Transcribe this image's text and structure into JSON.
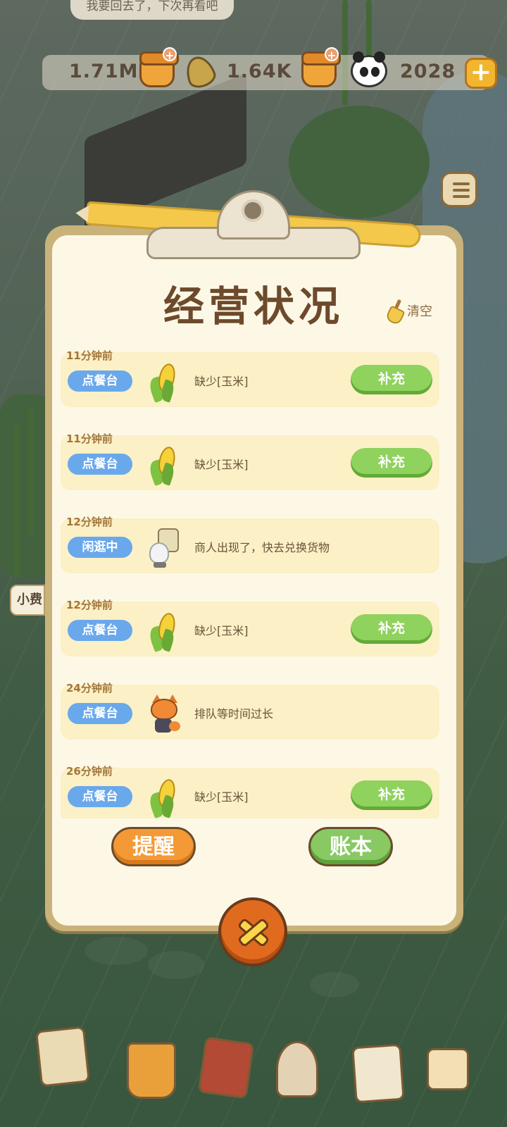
{
  "hud": {
    "speech_text": "我要回去了，下次再看吧",
    "resources": [
      {
        "icon": "honey-jar-icon",
        "value": "1.71M"
      },
      {
        "icon": "bamboo-leaf-icon",
        "value": "1.64K"
      },
      {
        "icon": "panda-icon",
        "value": "2028"
      }
    ],
    "side_tab_label": "小费"
  },
  "panel": {
    "title": "经营状况",
    "clear_label": "清空",
    "entries": [
      {
        "time": "11分钟前",
        "tag": "点餐台",
        "icon": "corn-icon",
        "message": "缺少[玉米]",
        "action": "补充"
      },
      {
        "time": "11分钟前",
        "tag": "点餐台",
        "icon": "corn-icon",
        "message": "缺少[玉米]",
        "action": "补充"
      },
      {
        "time": "12分钟前",
        "tag": "闲逛中",
        "icon": "merchant-icon",
        "message": "商人出现了，快去兑换货物",
        "action": ""
      },
      {
        "time": "12分钟前",
        "tag": "点餐台",
        "icon": "corn-icon",
        "message": "缺少[玉米]",
        "action": "补充"
      },
      {
        "time": "24分钟前",
        "tag": "点餐台",
        "icon": "fox-icon",
        "message": "排队等时间过长",
        "action": ""
      },
      {
        "time": "26分钟前",
        "tag": "点餐台",
        "icon": "corn-icon",
        "message": "缺少[玉米]",
        "action": "补充"
      }
    ],
    "remind_label": "提醒",
    "ledger_label": "账本",
    "close_icon": "close-icon"
  },
  "colors": {
    "title": "#6d4a2c",
    "tag_blue": "#6aa8ec",
    "action_green": "#8fd25d",
    "remind_orange": "#f39a36",
    "ledger_green": "#88c964"
  }
}
